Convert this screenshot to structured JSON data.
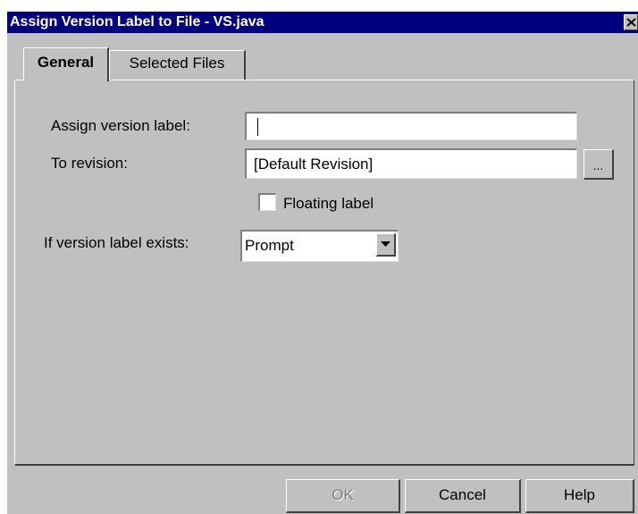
{
  "window": {
    "title": "Assign Version Label to File - VS.java"
  },
  "tabs": [
    {
      "label": "General",
      "selected": true
    },
    {
      "label": "Selected Files",
      "selected": false
    }
  ],
  "general": {
    "assign_label": "Assign version label:",
    "assign_value": "",
    "to_revision_label": "To revision:",
    "to_revision_value": "[Default Revision]",
    "browse_button": "...",
    "floating_label": "Floating label",
    "floating_checked": false,
    "exists_label": "If version label exists:",
    "exists_value": "Prompt"
  },
  "buttons": {
    "ok": "OK",
    "cancel": "Cancel",
    "help": "Help"
  },
  "icons": {
    "close": "close-icon",
    "dropdown": "chevron-down-icon"
  }
}
